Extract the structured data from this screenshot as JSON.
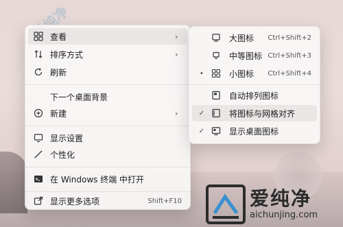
{
  "main_menu": {
    "items": [
      {
        "label": "查看",
        "icon": "grid-icon",
        "has_submenu": true
      },
      {
        "label": "排序方式",
        "icon": "sort-icon",
        "has_submenu": true
      },
      {
        "label": "刷新",
        "icon": "refresh-icon"
      },
      {
        "label": "下一个桌面背景",
        "icon": ""
      },
      {
        "label": "新建",
        "icon": "add-circle-icon",
        "has_submenu": true
      },
      {
        "label": "显示设置",
        "icon": "display-icon"
      },
      {
        "label": "个性化",
        "icon": "brush-icon"
      },
      {
        "label": "在 Windows 终端 中打开",
        "icon": "terminal-icon"
      },
      {
        "label": "显示更多选项",
        "icon": "share-icon",
        "shortcut": "Shift+F10"
      }
    ]
  },
  "view_submenu": {
    "items": [
      {
        "label": "大图标",
        "icon": "large-icons-icon",
        "shortcut": "Ctrl+Shift+2",
        "mark": ""
      },
      {
        "label": "中等图标",
        "icon": "medium-icons-icon",
        "shortcut": "Ctrl+Shift+3",
        "mark": ""
      },
      {
        "label": "小图标",
        "icon": "small-icons-icon",
        "shortcut": "Ctrl+Shift+4",
        "mark": "•"
      },
      {
        "label": "自动排列图标",
        "icon": "auto-arrange-icon",
        "shortcut": "",
        "mark": ""
      },
      {
        "label": "将图标与网格对齐",
        "icon": "align-grid-icon",
        "shortcut": "",
        "mark": "✓"
      },
      {
        "label": "显示桌面图标",
        "icon": "show-desktop-icons-icon",
        "shortcut": "",
        "mark": "✓"
      }
    ]
  },
  "watermark": {
    "text": "爱纯净"
  },
  "logo": {
    "cn": "爱纯净",
    "en": "aichunjing.com"
  }
}
